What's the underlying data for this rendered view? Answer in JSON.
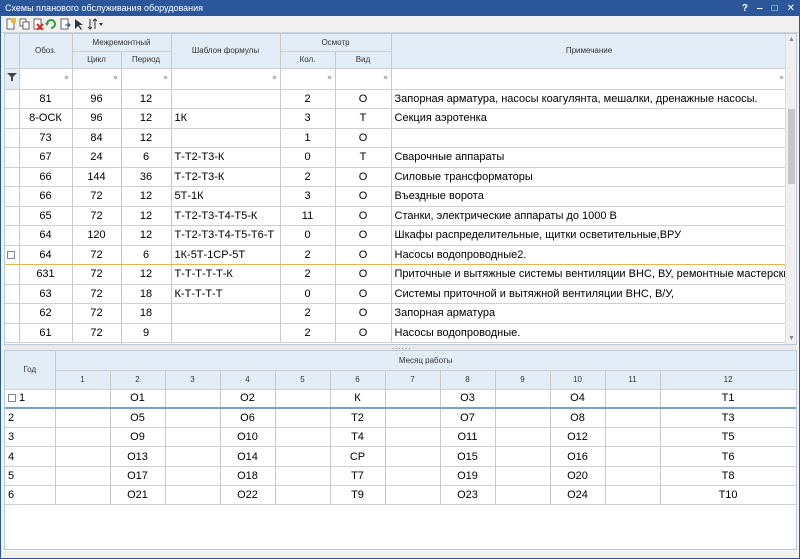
{
  "window": {
    "title": "Схемы планового обслуживания оборудования",
    "help_icon": "?",
    "minimize_icon": "‒",
    "maximize_icon": "□",
    "close_icon": "✕"
  },
  "colors": {
    "titlebar": "#2b579a",
    "header": "#e3edf8",
    "selected_border": "#e0b84a"
  },
  "toolbar": {
    "icons": [
      "new-document-icon",
      "copy-icon",
      "delete-icon",
      "refresh-icon",
      "export-icon",
      "pointer-icon",
      "sort-icon"
    ]
  },
  "top_grid": {
    "headers": {
      "obozn": "Обоз.",
      "mezhremont": "Межремонтный",
      "cycle": "Цикл",
      "period": "Период",
      "template": "Шаблон формулы",
      "osmotr": "Осмотр",
      "count": "Кол.",
      "type": "Вид",
      "note": "Примечание"
    },
    "rows": [
      {
        "o": "81",
        "c": "96",
        "p": "12",
        "t": "",
        "k": "2",
        "v": "О",
        "n": "Запорная арматура, насосы коагулянта, мешалки, дренажные насосы."
      },
      {
        "o": "8-ОСК",
        "c": "96",
        "p": "12",
        "t": "1К",
        "k": "3",
        "v": "Т",
        "n": "Секция аэротенка"
      },
      {
        "o": "73",
        "c": "84",
        "p": "12",
        "t": "",
        "k": "1",
        "v": "О",
        "n": ""
      },
      {
        "o": "67",
        "c": "24",
        "p": "6",
        "t": "Т-Т2-Т3-К",
        "k": "0",
        "v": "Т",
        "n": "Сварочные аппараты"
      },
      {
        "o": "66",
        "c": "144",
        "p": "36",
        "t": "Т-Т2-Т3-К",
        "k": "2",
        "v": "О",
        "n": "Силовые трансформаторы"
      },
      {
        "o": "66",
        "c": "72",
        "p": "12",
        "t": "5Т-1К",
        "k": "3",
        "v": "О",
        "n": "Въездные ворота"
      },
      {
        "o": "65",
        "c": "72",
        "p": "12",
        "t": "Т-Т2-Т3-Т4-Т5-К",
        "k": "11",
        "v": "О",
        "n": "Станки, электрические аппараты до 1000 В"
      },
      {
        "o": "64",
        "c": "120",
        "p": "12",
        "t": "Т-Т2-Т3-Т4-Т5-Т6-Т",
        "k": "0",
        "v": "О",
        "n": "Шкафы распределительные, щитки осветительные,ВРУ"
      },
      {
        "o": "64",
        "c": "72",
        "p": "6",
        "t": "1К-5Т-1СР-5Т",
        "k": "2",
        "v": "О",
        "n": "Насосы водопроводные2."
      },
      {
        "o": "631",
        "c": "72",
        "p": "12",
        "t": "Т-Т-Т-Т-Т-К",
        "k": "2",
        "v": "О",
        "n": "Приточные и вытяжные системы вентиляции ВНС, ВУ, ремонтные мастерские, ("
      },
      {
        "o": "63",
        "c": "72",
        "p": "18",
        "t": "К-Т-Т-Т-Т",
        "k": "0",
        "v": "О",
        "n": "Системы приточной и вытяжной вентиляции ВНС, В/У,"
      },
      {
        "o": "62",
        "c": "72",
        "p": "18",
        "t": "",
        "k": "2",
        "v": "О",
        "n": "Запорная арматура"
      },
      {
        "o": "61",
        "c": "72",
        "p": "9",
        "t": "",
        "k": "2",
        "v": "О",
        "n": "Насосы водопроводные."
      }
    ]
  },
  "bottom_grid": {
    "headers": {
      "year": "Год",
      "month_work": "Месяц работы",
      "months": [
        "1",
        "2",
        "3",
        "4",
        "5",
        "6",
        "7",
        "8",
        "9",
        "10",
        "11",
        "12"
      ]
    },
    "rows": [
      {
        "year": "1",
        "m": [
          "",
          "О1",
          "",
          "О2",
          "",
          "К",
          "",
          "О3",
          "",
          "О4",
          "",
          "Т1"
        ]
      },
      {
        "year": "2",
        "m": [
          "",
          "О5",
          "",
          "О6",
          "",
          "Т2",
          "",
          "О7",
          "",
          "О8",
          "",
          "Т3"
        ]
      },
      {
        "year": "3",
        "m": [
          "",
          "О9",
          "",
          "О10",
          "",
          "Т4",
          "",
          "О11",
          "",
          "О12",
          "",
          "Т5"
        ]
      },
      {
        "year": "4",
        "m": [
          "",
          "О13",
          "",
          "О14",
          "",
          "СР",
          "",
          "О15",
          "",
          "О16",
          "",
          "Т6"
        ]
      },
      {
        "year": "5",
        "m": [
          "",
          "О17",
          "",
          "О18",
          "",
          "Т7",
          "",
          "О19",
          "",
          "О20",
          "",
          "Т8"
        ]
      },
      {
        "year": "6",
        "m": [
          "",
          "О21",
          "",
          "О22",
          "",
          "Т9",
          "",
          "О23",
          "",
          "О24",
          "",
          "Т10"
        ]
      }
    ]
  }
}
